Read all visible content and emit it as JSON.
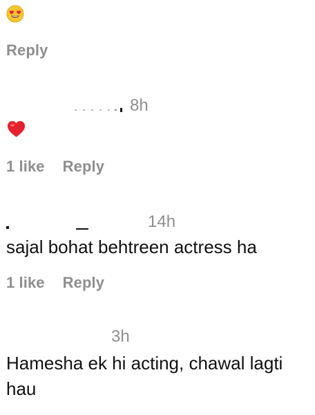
{
  "comments": [
    {
      "text": "",
      "icon": "heart-eyes-emoji-icon",
      "likes_label": "",
      "reply_label": "Reply"
    },
    {
      "time": "8h",
      "icon": "red-heart-emoji-icon",
      "likes_label": "1 like",
      "reply_label": "Reply"
    },
    {
      "time": "14h",
      "text": "sajal bohat behtreen actress ha",
      "likes_label": "1 like",
      "reply_label": "Reply"
    },
    {
      "time": "3h",
      "text": "Hamesha ek hi acting, chawal lagti hau"
    }
  ],
  "colors": {
    "text": "#111111",
    "secondary": "#8e8e8e",
    "heart": "#e4222f",
    "emoji_face": "#f7c531"
  }
}
